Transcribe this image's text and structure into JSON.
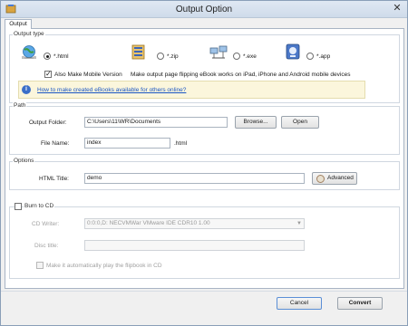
{
  "window": {
    "title": "Output Option",
    "close_symbol": "✕"
  },
  "tab": {
    "label": "Output"
  },
  "output_type": {
    "group_label": "Output type",
    "options": [
      {
        "label": "*.html",
        "selected": true,
        "icon": "globe-network-icon"
      },
      {
        "label": "*.zip",
        "selected": false,
        "icon": "zip-archive-icon"
      },
      {
        "label": "*.exe",
        "selected": false,
        "icon": "computer-network-icon"
      },
      {
        "label": "*.app",
        "selected": false,
        "icon": "mac-app-icon"
      }
    ],
    "mobile_checkbox_label": "Also Make Mobile Version",
    "mobile_checked": true,
    "mobile_description": "Make output page flipping eBook works on iPad, iPhone and Android mobile devices",
    "info_link": "How to make created eBooks available for others online?"
  },
  "path": {
    "group_label": "Path",
    "output_folder_label": "Output Folder:",
    "output_folder_value": "C:\\Users\\11\\WR\\Documents",
    "browse_label": "Browse...",
    "open_label": "Open",
    "file_name_label": "File Name:",
    "file_name_value": "index",
    "file_ext": ".html"
  },
  "options": {
    "group_label": "Options",
    "html_title_label": "HTML Title:",
    "html_title_value": "demo",
    "advanced_label": "Advanced"
  },
  "burn_cd": {
    "checkbox_label": "Burn to CD",
    "checked": false,
    "cd_writer_label": "CD Writer:",
    "cd_writer_value": "0:0:0,D: NECVMWar VMware IDE CDR10 1.00",
    "disc_title_label": "Disc title:",
    "disc_title_value": "",
    "autoplay_label": "Make it automatically play the flipbook in CD",
    "autoplay_checked": false
  },
  "footer": {
    "cancel_label": "Cancel",
    "convert_label": "Convert"
  },
  "colors": {
    "accent": "#3b6fc9",
    "link": "#1a56c4",
    "info_bg": "#fbf6dc"
  }
}
